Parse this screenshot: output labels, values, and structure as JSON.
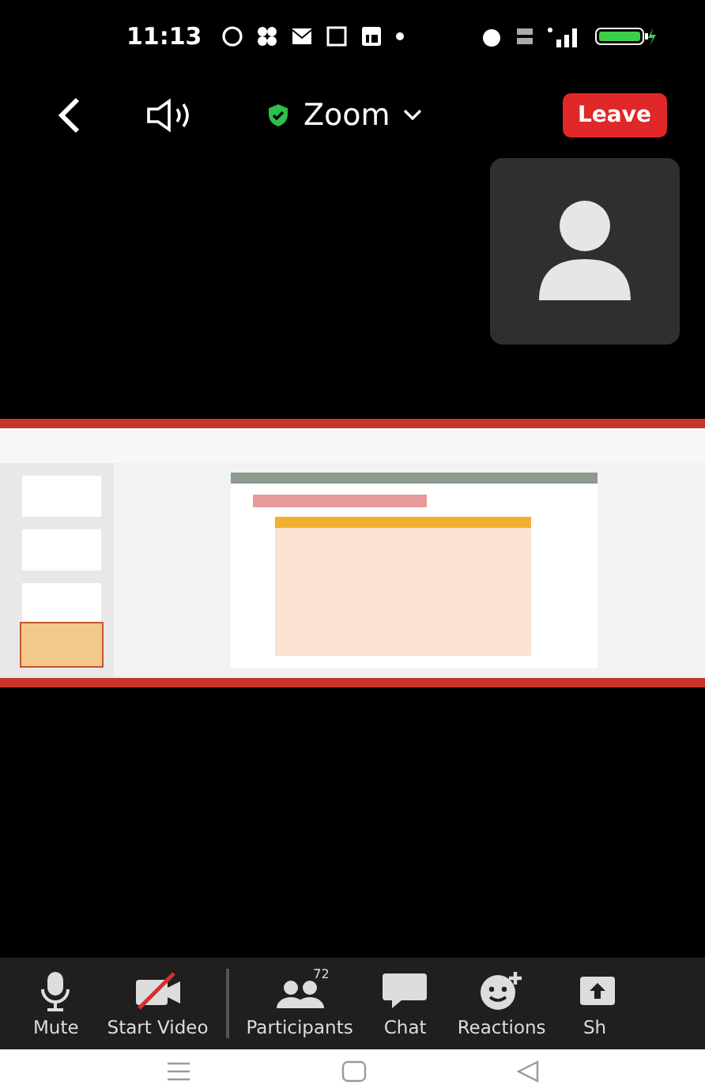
{
  "status_bar": {
    "time": "11:13"
  },
  "meeting_bar": {
    "title": "Zoom",
    "leave_label": "Leave"
  },
  "toolbar": [
    {
      "kind": "mic",
      "label": "Mute"
    },
    {
      "kind": "video-off",
      "label": "Start Video"
    },
    {
      "kind": "participants",
      "label": "Participants",
      "count": "72"
    },
    {
      "kind": "chat",
      "label": "Chat"
    },
    {
      "kind": "reactions",
      "label": "Reactions"
    },
    {
      "kind": "share",
      "label": "Sh"
    }
  ]
}
